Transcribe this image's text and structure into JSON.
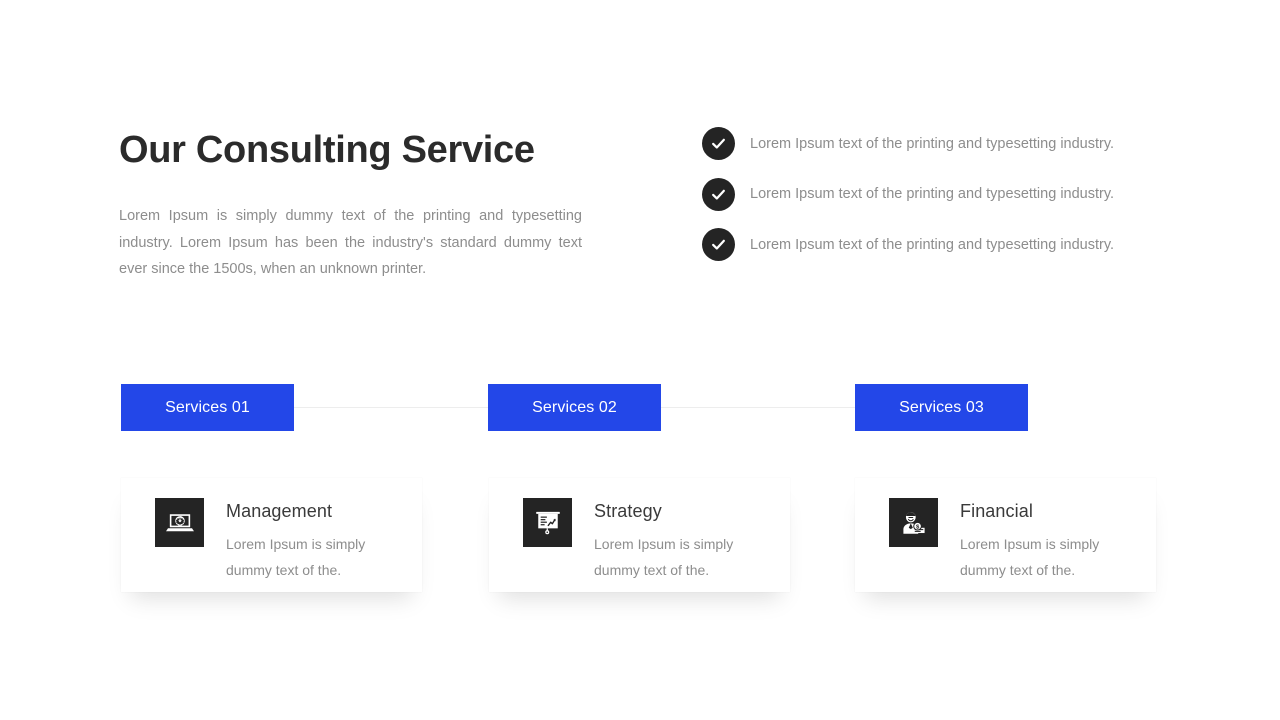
{
  "theme": {
    "accent_blue": "#2347E8",
    "icon_dark": "#242424",
    "heading_color": "#2B2B2B",
    "body_text_color": "#8D8D8D",
    "background": "#FFFFFF"
  },
  "heading": {
    "title": "Our Consulting Service",
    "body": "Lorem Ipsum is simply dummy text of the printing and typesetting industry.  Lorem Ipsum has been the industry's standard dummy text ever since the 1500s,  when an unknown printer."
  },
  "checklist": {
    "items": [
      {
        "icon": "check-circle-icon",
        "text": "Lorem Ipsum text of the printing and typesetting industry."
      },
      {
        "icon": "check-circle-icon",
        "text": "Lorem Ipsum text of the printing and typesetting industry."
      },
      {
        "icon": "check-circle-icon",
        "text": "Lorem Ipsum text of the printing and typesetting industry."
      }
    ]
  },
  "tabs": [
    {
      "label": "Services 01"
    },
    {
      "label": "Services 02"
    },
    {
      "label": "Services 03"
    }
  ],
  "cards": [
    {
      "icon": "laptop-gear-icon",
      "title": "Management",
      "description": "Lorem Ipsum is simply dummy text of the."
    },
    {
      "icon": "presentation-chart-icon",
      "title": "Strategy",
      "description": "Lorem Ipsum is simply dummy text of the."
    },
    {
      "icon": "businessman-dollar-icon",
      "title": "Financial",
      "description": "Lorem Ipsum is simply dummy text of the."
    }
  ]
}
